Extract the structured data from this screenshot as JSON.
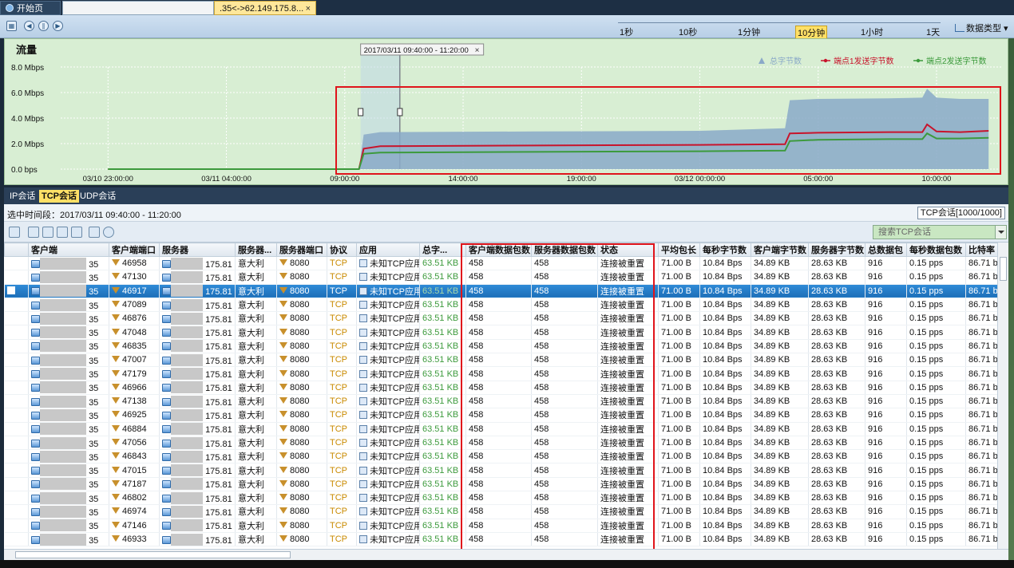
{
  "tabs": [
    {
      "label": "开始页"
    },
    {
      "label": ""
    },
    {
      "label": ".35<->62.149.175.8...",
      "close": "×"
    }
  ],
  "timeline": {
    "options": [
      "1秒",
      "10秒",
      "1分钟",
      "10分钟",
      "1小时",
      "1天"
    ],
    "active": "10分钟"
  },
  "datatype_label": "数据类型",
  "chart": {
    "title": "流量",
    "selection_label": "2017/03/11  09:40:00 - 11:20:00",
    "selection_close": "×"
  },
  "chart_data": {
    "type": "area",
    "ylabel": "",
    "y_ticks": [
      "8.0 Mbps",
      "6.0 Mbps",
      "4.0 Mbps",
      "2.0 Mbps",
      "0.0 bps"
    ],
    "ylim": [
      0,
      8
    ],
    "y_unit": "Mbps",
    "x_ticks": [
      "03/10 23:00:00",
      "03/11 04:00:00",
      "09:00:00",
      "14:00:00",
      "19:00:00",
      "03/12 00:00:00",
      "05:00:00",
      "10:00:00"
    ],
    "x_hours": [
      0,
      5,
      10,
      15,
      20,
      25,
      30,
      35
    ],
    "xlim": [
      -2,
      37.8
    ],
    "legend_position": "top-right",
    "series": [
      {
        "name": "总字节数",
        "color": "#8aa9c8",
        "x": [
          0,
          10.6,
          10.8,
          11.5,
          18,
          25,
          28.6,
          28.8,
          30,
          33,
          34.4,
          34.6,
          35,
          36,
          37.2
        ],
        "values": [
          0,
          0,
          2.7,
          2.9,
          2.95,
          3.0,
          3.2,
          5.4,
          5.5,
          5.55,
          5.6,
          6.3,
          5.6,
          5.5,
          5.5
        ]
      },
      {
        "name": "端点1发送字节数",
        "color": "#c8142c",
        "x": [
          0,
          10.6,
          10.8,
          11.5,
          18,
          25,
          28.6,
          28.8,
          30,
          33,
          34.4,
          34.6,
          35,
          36,
          37.2
        ],
        "values": [
          0,
          0,
          1.6,
          1.8,
          1.85,
          1.9,
          1.95,
          2.8,
          2.85,
          2.9,
          2.9,
          3.5,
          2.95,
          2.9,
          3.0
        ]
      },
      {
        "name": "端点2发送字节数",
        "color": "#3c9a3c",
        "x": [
          0,
          10.6,
          10.8,
          11.5,
          18,
          25,
          28.6,
          28.8,
          30,
          33,
          34.4,
          34.6,
          35,
          36,
          37.2
        ],
        "values": [
          0,
          0,
          1.2,
          1.3,
          1.35,
          1.4,
          1.45,
          2.2,
          2.3,
          2.35,
          2.35,
          2.8,
          2.4,
          2.4,
          2.45
        ]
      }
    ]
  },
  "session_tabs": [
    "IP会话",
    "TCP会话",
    "UDP会话"
  ],
  "session_tab_active": "TCP会话",
  "selected_time": "选中时间段：2017/03/11  09:40:00 - 11:20:00",
  "tcp_count": "TCP会话[1000/1000]",
  "search_placeholder": "搜索TCP会话",
  "table": {
    "headers": [
      "客户端",
      "客户端端口",
      "服务器",
      "服务器...",
      "服务器端口",
      "协议",
      "应用",
      "总字...",
      "客户端数据包数",
      "服务器数据包数",
      "状态",
      "平均包长",
      "每秒字节数",
      "客户端字节数",
      "服务器字节数",
      "总数据包",
      "每秒数据包数",
      "比特率"
    ],
    "common": {
      "client_suffix": "35",
      "server_suffix": "175.81",
      "country": "意大利",
      "server_port": "8080",
      "protocol": "TCP",
      "app": "未知TCP应用",
      "total": "63.51 KB",
      "client_pkts": "458",
      "server_pkts": "458",
      "state": "连接被重置",
      "avg_len": "71.00 B",
      "bps": "10.84 Bps",
      "client_bytes": "34.89 KB",
      "server_bytes": "28.63 KB",
      "total_pkts": "916",
      "pps": "0.15 pps",
      "bitrate": "86.71 b"
    },
    "client_ports": [
      "46958",
      "47130",
      "46917",
      "47089",
      "46876",
      "47048",
      "46835",
      "47007",
      "47179",
      "46966",
      "47138",
      "46925",
      "46884",
      "47056",
      "46843",
      "47015",
      "47187",
      "46802",
      "46974",
      "47146",
      "46933"
    ],
    "selected_row": 2
  }
}
